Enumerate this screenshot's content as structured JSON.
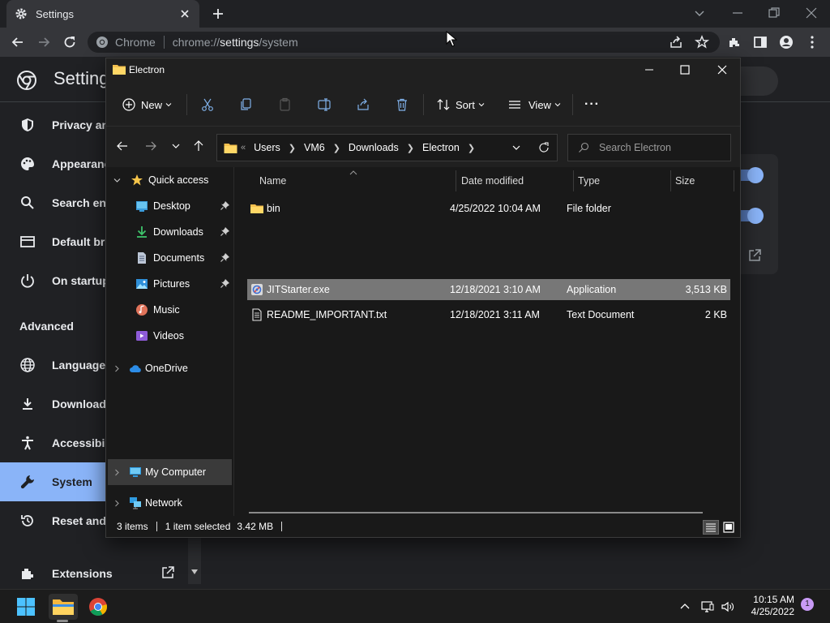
{
  "chrome": {
    "tab_title": "Settings",
    "omni_label": "Chrome",
    "url_scheme": "chrome://",
    "url_host": "settings",
    "url_path": "/system"
  },
  "settings": {
    "title": "Settings",
    "nav": [
      {
        "label": "Privacy and security",
        "icon": "shield-icon"
      },
      {
        "label": "Appearance",
        "icon": "palette-icon"
      },
      {
        "label": "Search engine",
        "icon": "search-icon"
      },
      {
        "label": "Default browser",
        "icon": "browser-icon"
      },
      {
        "label": "On startup",
        "icon": "power-icon"
      }
    ],
    "advanced_label": "Advanced",
    "advanced_nav": [
      {
        "label": "Languages",
        "icon": "globe-icon"
      },
      {
        "label": "Downloads",
        "icon": "download-icon"
      },
      {
        "label": "Accessibility",
        "icon": "accessibility-icon"
      },
      {
        "label": "System",
        "icon": "wrench-icon",
        "active": true
      },
      {
        "label": "Reset and clean up",
        "icon": "reset-icon"
      }
    ],
    "extensions_label": "Extensions",
    "accent_color": "#8ab4f8"
  },
  "explorer": {
    "title": "Electron",
    "commands": {
      "new": "New",
      "sort": "Sort",
      "view": "View",
      "more": "···"
    },
    "breadcrumb": [
      "Users",
      "VM6",
      "Downloads",
      "Electron"
    ],
    "breadcrumb_overflow": "«",
    "search_placeholder": "Search Electron",
    "nav_pane": {
      "quick_access": "Quick access",
      "pinned": [
        {
          "label": "Desktop",
          "icon": "desktop-icon",
          "pinned": true
        },
        {
          "label": "Downloads",
          "icon": "downloads-icon",
          "pinned": true
        },
        {
          "label": "Documents",
          "icon": "documents-icon",
          "pinned": true
        },
        {
          "label": "Pictures",
          "icon": "pictures-icon",
          "pinned": true
        },
        {
          "label": "Music",
          "icon": "music-icon",
          "pinned": false
        },
        {
          "label": "Videos",
          "icon": "videos-icon",
          "pinned": false
        }
      ],
      "onedrive": "OneDrive",
      "my_computer": "My Computer",
      "network": "Network"
    },
    "columns": {
      "name": "Name",
      "date": "Date modified",
      "type": "Type",
      "size": "Size"
    },
    "files": [
      {
        "name": "bin",
        "date": "4/25/2022 10:04 AM",
        "type": "File folder",
        "size": "",
        "icon": "folder-icon",
        "selected": false
      },
      {
        "name": "JITStarter.exe",
        "date": "12/18/2021 3:10 AM",
        "type": "Application",
        "size": "3,513 KB",
        "icon": "exe-icon",
        "selected": true
      },
      {
        "name": "README_IMPORTANT.txt",
        "date": "12/18/2021 3:11 AM",
        "type": "Text Document",
        "size": "2 KB",
        "icon": "text-file-icon",
        "selected": false
      }
    ],
    "status": {
      "items": "3 items",
      "selected": "1 item selected",
      "size": "3.42 MB"
    }
  },
  "taskbar": {
    "time": "10:15 AM",
    "date": "4/25/2022",
    "notifications": "1"
  }
}
